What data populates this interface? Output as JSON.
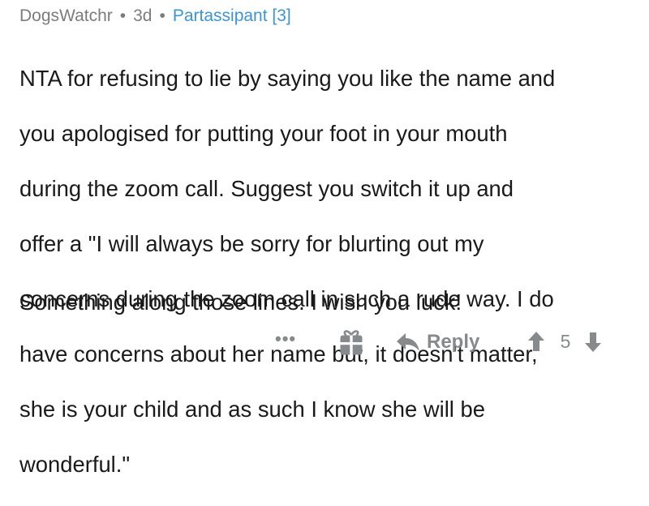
{
  "comment": {
    "author": "DogsWatchr",
    "separator": "•",
    "age": "3d",
    "flair": "Partassipant [3]",
    "body_lines": [
      "NTA for refusing to lie by saying you like the name and",
      "you apologised for putting your foot in your mouth",
      "during the zoom call.  Suggest you switch it up and",
      "offer a \"I will always be sorry for blurting out my",
      "concerns during the zoom call in such a rude way. I do",
      "have concerns about her name but, it doesn't matter,",
      "she is your child and as such I know she will be",
      "wonderful.\""
    ],
    "second_paragraph": "Something along those lines. I wish you luck!"
  },
  "actions": {
    "more_label": "•••",
    "gift_icon": "gift-icon",
    "reply_icon": "reply-arrow-icon",
    "reply_label": "Reply",
    "upvote_icon": "arrow-up-icon",
    "score": "5",
    "downvote_icon": "arrow-down-icon"
  },
  "colors": {
    "text": "#1a1a1b",
    "meta": "#7c7c7c",
    "flair": "#3a95d6",
    "actions": "#878a8c"
  }
}
